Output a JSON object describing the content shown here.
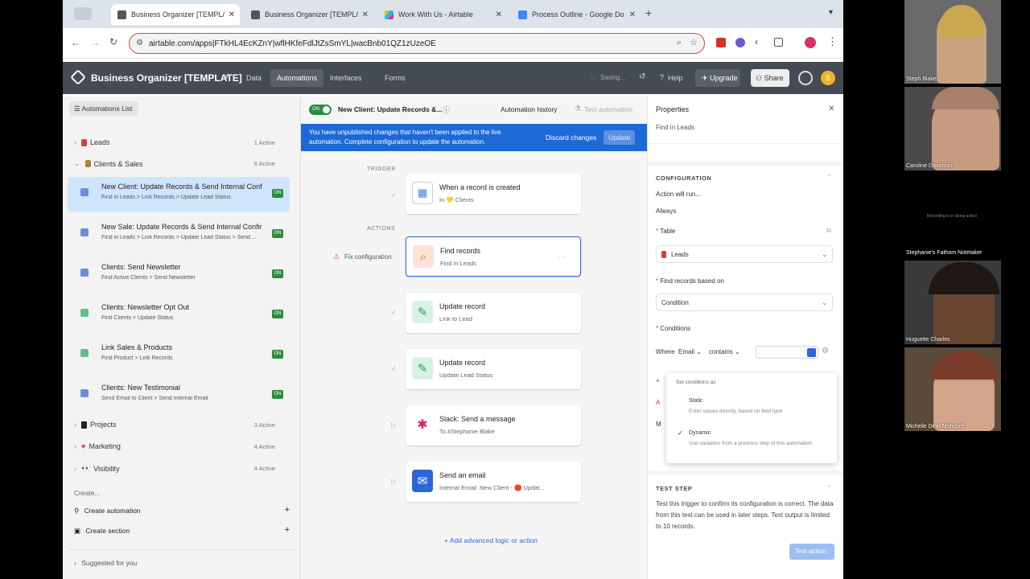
{
  "browser": {
    "tabs": [
      {
        "label": "Business Organizer [TEMPL/",
        "active": true
      },
      {
        "label": "Business Organizer [TEMPL/"
      },
      {
        "label": "Work With Us - Airtable"
      },
      {
        "label": "Process Outline - Google Do"
      }
    ],
    "url": "airtable.com/apps|FTkHL4EcKZnY|wflHKfeFdlJtZsSmYL|wacBnb01QZ1zUzeOE"
  },
  "app": {
    "base_title": "Business Organizer [TEMPLATE]",
    "nav": [
      "Data",
      "Automations",
      "Interfaces",
      "Forms"
    ],
    "saving": "Saving...",
    "help": "Help",
    "upgrade": "Upgrade",
    "share": "Share",
    "avatar_initial": "S"
  },
  "sidebar": {
    "header": "Automations List",
    "groups": {
      "leads": {
        "label": "Leads",
        "count": "1 Active"
      },
      "clients_sales": {
        "label": "Clients & Sales",
        "count": "6 Active"
      },
      "projects": {
        "label": "Projects",
        "count": "3 Active"
      },
      "marketing": {
        "label": "Marketing",
        "count": "4 Active"
      },
      "visibility": {
        "label": "Visibility",
        "count": "4 Active"
      }
    },
    "items": [
      {
        "title": "New Client: Update Records & Send Internal Confi...",
        "sub": "Find in Leads > Link Records > Update Lead Status",
        "status": "ON"
      },
      {
        "title": "New Sale: Update Records & Send Internal Confir...",
        "sub": "Find in Leads > Link Records > Update Lead Status > Send ...",
        "status": "ON"
      },
      {
        "title": "Clients: Send Newsletter",
        "sub": "Find Active Clients > Send Newsletter",
        "status": "ON"
      },
      {
        "title": "Clients: Newsletter Opt Out",
        "sub": "Find Clients > Update Status",
        "status": "ON"
      },
      {
        "title": "Link Sales & Products",
        "sub": "Find Product > Link Records",
        "status": "ON"
      },
      {
        "title": "Clients: New Testimonial",
        "sub": "Send Email to Client > Send Internal Email",
        "status": "ON"
      }
    ],
    "create": "Create...",
    "create_automation": "Create automation",
    "create_section": "Create section",
    "suggested": "Suggested for you"
  },
  "canvas": {
    "toggle": "ON",
    "automation_name": "New Client: Update Records &...",
    "history": "Automation history",
    "test": "Test automation",
    "banner_text": "You have unpublished changes that haven't been applied to the live automation. Complete configuration to update the automation.",
    "discard": "Discard changes",
    "update": "Update",
    "trigger_label": "TRIGGER",
    "actions_label": "ACTIONS",
    "fix_config": "Fix configuration",
    "steps": [
      {
        "title": "When a record is created",
        "sub": "In 💛 Clients"
      },
      {
        "title": "Find records",
        "sub": "Find in Leads"
      },
      {
        "title": "Update record",
        "sub": "Link to Lead"
      },
      {
        "title": "Update record",
        "sub": "Update Lead Status"
      },
      {
        "title": "Slack: Send a message",
        "sub": "To #Stephanie Blake"
      },
      {
        "title": "Send an email",
        "sub": "Internal Email: New Client - 🛑 Updat..."
      }
    ],
    "add_logic": "+ Add advanced logic or action"
  },
  "properties": {
    "title": "Properties",
    "find_in": "Find in Leads",
    "configuration": "CONFIGURATION",
    "action_will_run": "Action will run...",
    "always": "Always",
    "table_label": "Table",
    "table_value": "Leads",
    "find_based_label": "Find records based on",
    "find_based_value": "Condition",
    "conditions_label": "Conditions",
    "where": "Where",
    "field": "Email",
    "operator": "contains",
    "set_conditions_as": "Set conditions as",
    "static": "Static",
    "static_desc": "Enter values directly, based on field type",
    "dynamic": "Dynamic",
    "dynamic_desc": "Use variables from a previous step of this automation",
    "test_step": "TEST STEP",
    "test_desc": "Test this trigger to confirm its configuration is correct. The data from this test can be used in later steps. Test output is limited to 10 records.",
    "test_action": "Test action"
  },
  "participants": [
    {
      "name": "Steph Blake"
    },
    {
      "name": "Caroline Davidson"
    },
    {
      "name": "Stephanie's Fathom Notetaker",
      "note": "Recording is in listing action"
    },
    {
      "name": "Huguette Charles"
    },
    {
      "name": "Michelle Dear Moncrief"
    }
  ]
}
